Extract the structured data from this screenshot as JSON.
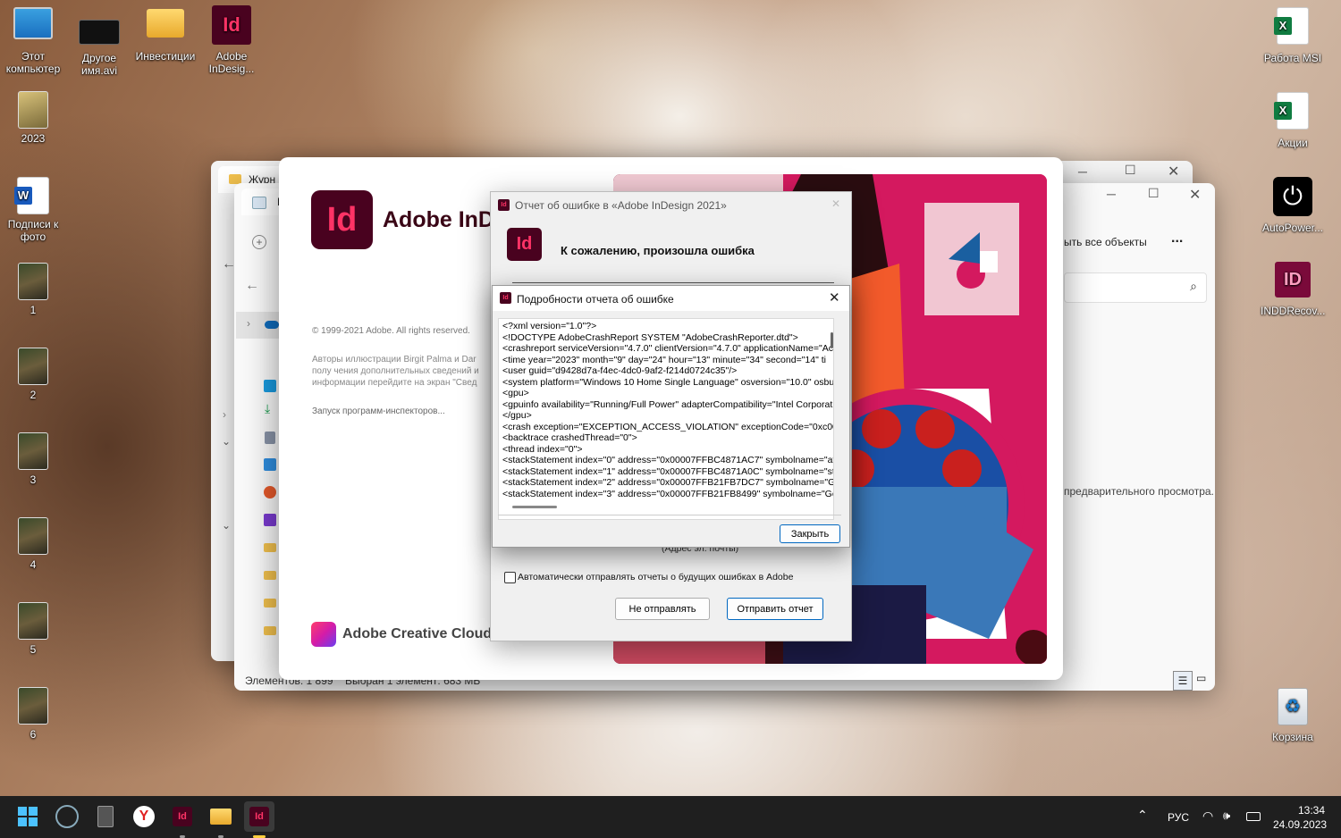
{
  "desktop": {
    "icons_left": [
      {
        "label": "Этот компьютер"
      },
      {
        "label": "Другое имя.avi"
      },
      {
        "label": "Инвестиции"
      },
      {
        "label": "Adobe InDesig..."
      },
      {
        "label": "2023"
      },
      {
        "label": "Подписи к фото"
      },
      {
        "label": "1"
      },
      {
        "label": "2"
      },
      {
        "label": "3"
      },
      {
        "label": "4"
      },
      {
        "label": "5"
      },
      {
        "label": "6"
      }
    ],
    "icons_right": [
      {
        "label": "Работа MSI"
      },
      {
        "label": "Акции"
      },
      {
        "label": "AutoPower..."
      },
      {
        "label": "INDDRecov..."
      },
      {
        "label": "Корзина"
      }
    ]
  },
  "explorer_back": {
    "tab_title": "Журн"
  },
  "explorer_front": {
    "tab_title": "К",
    "select_all": "ыть все объекты",
    "more": "...",
    "preview_text": "предварительного просмотра.",
    "status_items": "Элементов: 1 899",
    "status_selected": "Выбран 1 элемент: 683 МБ",
    "nav_label": "Эл"
  },
  "splash": {
    "logo_text": "Id",
    "title": "Adobe InDe",
    "copyright": "© 1999-2021 Adobe. All rights reserved.",
    "illustration_credits": "Авторы иллюстрации Birgit Palma и Dar\nполу чения дополнительных сведений и\nинформации перейдите на экран \"Свед",
    "loading": "Запуск программ-инспекторов...",
    "cc_label": "Adobe Creative Cloud"
  },
  "crash_dialog": {
    "title": "Отчет об ошибке в «Adobe InDesign 2021»",
    "logo_text": "Id",
    "heading": "К сожалению, произошла ошибка",
    "email_hint": "(Адрес эл. почты)",
    "auto_send_label": "Автоматически отправлять отчеты о будущих ошибках в Adobe",
    "dont_send": "Не отправлять",
    "send_report": "Отправить отчет"
  },
  "details_dialog": {
    "title": "Подробности отчета об ошибке",
    "xml_lines": [
      "<?xml version=\"1.0\"?>",
      "<!DOCTYPE AdobeCrashReport SYSTEM \"AdobeCrashReporter.dtd\">",
      "<crashreport serviceVersion=\"4.7.0\" clientVersion=\"4.7.0\" applicationName=\"Ac",
      "<time year=\"2023\" month=\"9\" day=\"24\" hour=\"13\" minute=\"34\" second=\"14\" ti",
      "<user guid=\"d9428d7a-f4ec-4dc0-9af2-f214d0724c35\"/>",
      "<system platform=\"Windows 10 Home Single Language\" osversion=\"10.0\" osbu",
      "<gpu>",
      "<gpuinfo availability=\"Running/Full Power\" adapterCompatibility=\"Intel Corporat",
      "</gpu>",
      "<crash exception=\"EXCEPTION_ACCESS_VIOLATION\" exceptionCode=\"0xc0000(",
      "<backtrace crashedThread=\"0\">",
      "<thread index=\"0\">",
      "<stackStatement index=\"0\" address=\"0x00007FFBC4871AC7\" symbolname=\"atc",
      "<stackStatement index=\"1\" address=\"0x00007FFBC4871A0C\" symbolname=\"str",
      "<stackStatement index=\"2\" address=\"0x00007FFB21FB7DC7\" symbolname=\"Gel",
      "<stackStatement index=\"3\" address=\"0x00007FFB21FB8499\" symbolname=\"Get"
    ],
    "close_button": "Закрыть"
  },
  "taskbar": {
    "language": "РУС",
    "time": "13:34",
    "date": "24.09.2023"
  },
  "colors": {
    "indesign_bg": "#49021f",
    "indesign_fg": "#ff3366",
    "accent": "#0067c0"
  }
}
